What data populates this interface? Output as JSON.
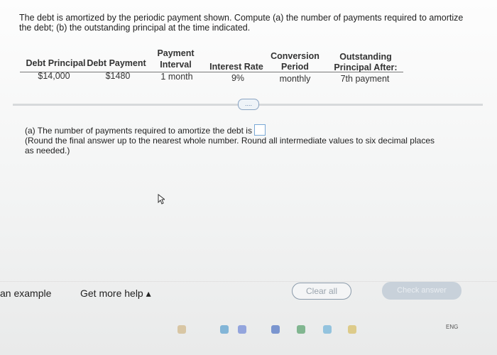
{
  "prompt": {
    "line1": "The debt is amortized by the periodic payment shown. Compute (a) the number of payments required to amortize",
    "line2": "the debt; (b) the outstanding principal at the time indicated."
  },
  "table": {
    "headers": {
      "debt_principal": "Debt Principal",
      "debt_payment": "Debt Payment",
      "payment_interval_1": "Payment",
      "payment_interval_2": "Interval",
      "interest_rate": "Interest Rate",
      "conversion_1": "Conversion",
      "conversion_2": "Period",
      "outstanding_1": "Outstanding",
      "outstanding_2": "Principal After:"
    },
    "values": {
      "debt_principal": "$14,000",
      "debt_payment": "$1480",
      "payment_interval": "1 month",
      "interest_rate": "9%",
      "conversion_period": "monthly",
      "outstanding_after": "7th payment"
    }
  },
  "more_button": "....",
  "question": {
    "part_a": "(a) The number of payments required to amortize the debt is",
    "instruction_1": "(Round the final answer up to the nearest whole number. Round all intermediate values to six decimal places",
    "instruction_2": "as needed.)"
  },
  "footer": {
    "example": "an example",
    "help": "Get more help",
    "help_arrow": "▴",
    "clear_all": "Clear all",
    "check_answer": "Check answer",
    "lang": "ENG"
  }
}
